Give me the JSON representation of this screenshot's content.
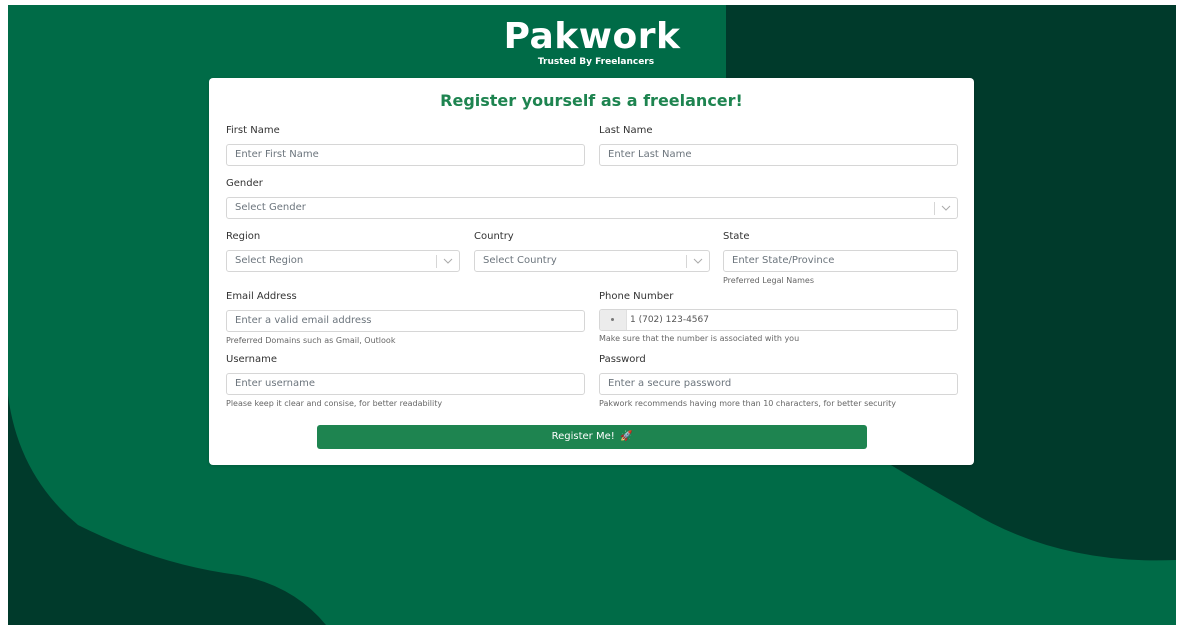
{
  "brand": {
    "name": "Pakwork",
    "tagline": "Trusted By Freelancers"
  },
  "colors": {
    "primary_green": "#006b47",
    "dark_green": "#003a2b",
    "button_green": "#1e8450",
    "title_green": "#1e8450"
  },
  "form": {
    "title": "Register yourself as a freelancer!",
    "first_name": {
      "label": "First Name",
      "placeholder": "Enter First Name"
    },
    "last_name": {
      "label": "Last Name",
      "placeholder": "Enter Last Name"
    },
    "gender": {
      "label": "Gender",
      "placeholder": "Select Gender"
    },
    "region": {
      "label": "Region",
      "placeholder": "Select Region"
    },
    "country": {
      "label": "Country",
      "placeholder": "Select Country"
    },
    "state": {
      "label": "State",
      "placeholder": "Enter State/Province",
      "hint": "Preferred Legal Names"
    },
    "email": {
      "label": "Email Address",
      "placeholder": "Enter a valid email address",
      "hint": "Preferred Domains such as Gmail, Outlook"
    },
    "phone": {
      "label": "Phone Number",
      "placeholder": "1 (702) 123-4567",
      "hint": "Make sure that the number is associated with you"
    },
    "username": {
      "label": "Username",
      "placeholder": "Enter username",
      "hint": "Please keep it clear and consise, for better readability"
    },
    "password": {
      "label": "Password",
      "placeholder": "Enter a secure password",
      "hint": "Pakwork recommends having more than 10 characters, for better security"
    },
    "submit_label": "Register Me!",
    "submit_icon": "rocket-icon"
  }
}
